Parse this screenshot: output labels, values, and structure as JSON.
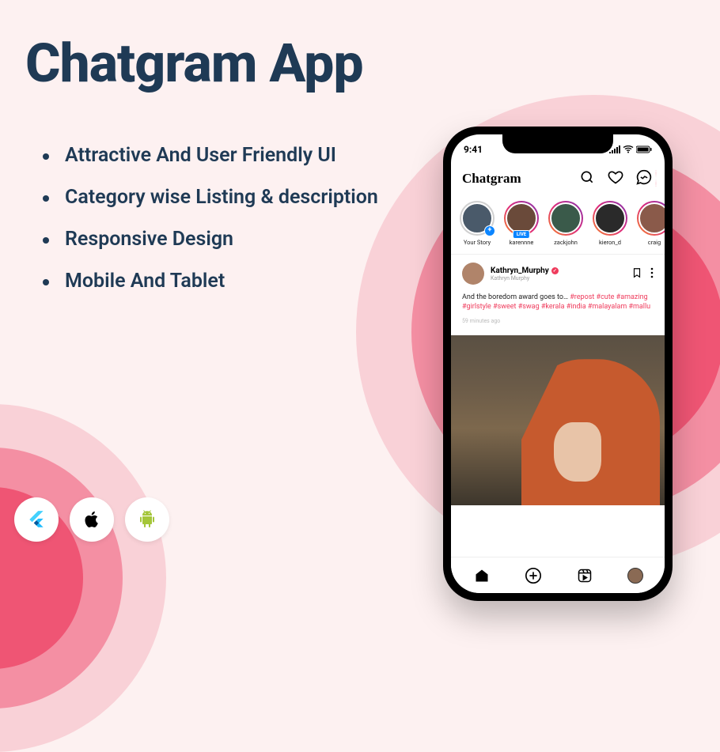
{
  "hero": {
    "title": "Chatgram App"
  },
  "features": [
    "Attractive And User Friendly UI",
    "Category wise Listing & description",
    "Responsive Design",
    "Mobile And Tablet"
  ],
  "platforms": [
    "flutter",
    "apple",
    "android"
  ],
  "phone": {
    "status_time": "9:41",
    "app_brand": "Chatgram",
    "stories": [
      {
        "name": "Your Story",
        "own": true
      },
      {
        "name": "karennne",
        "live": true
      },
      {
        "name": "zackjohn"
      },
      {
        "name": "kieron_d"
      },
      {
        "name": "craig"
      }
    ],
    "post": {
      "username": "Kathryn_Murphy",
      "realname": "Kathryn Murphy",
      "caption_plain": "And the boredom award goes to… ",
      "caption_tags": "#repost #cute #amazing #girlstyle #sweet #swag #kerala #india #malayalam #mallu",
      "time_ago": "59 minutes ago"
    }
  }
}
